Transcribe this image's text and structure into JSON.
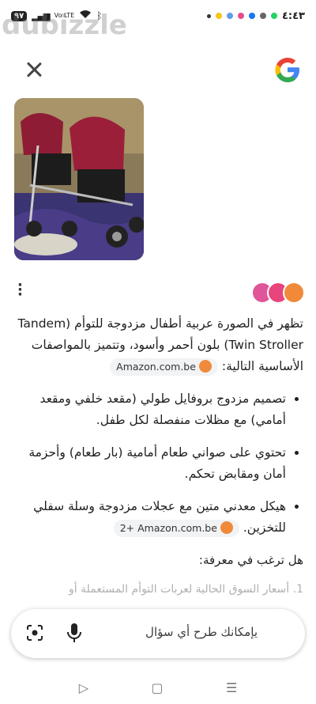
{
  "status_bar": {
    "time": "٤:٤٣",
    "battery": "٩٧",
    "network": "Vo LTE",
    "watermark": "dubizzle"
  },
  "header": {
    "close_label": "close",
    "logo": "G"
  },
  "answer": {
    "intro": "تظهر في الصورة عربية أطفال مزدوجة للتوأم (Tandem Twin Stroller) بلون أحمر وأسود، وتتميز بالمواصفات الأساسية التالية:",
    "intro_source": "Amazon.com.be",
    "bullets": [
      {
        "text": "تصميم مزدوج بروفايل طولي (مقعد خلفي ومقعد أمامي) مع مظلات منفصلة لكل طفل.",
        "source": ""
      },
      {
        "text": "تحتوي على صواني طعام أمامية (بار طعام) وأحزمة أمان ومقابض تحكم.",
        "source": ""
      },
      {
        "text": "هيكل معدني متين مع عجلات مزدوجة وسلة سفلي للتخزين.",
        "source": "2+ Amazon.com.be"
      }
    ],
    "question": "هل ترغب في معرفة:",
    "followup": "1. أسعار السوق الحالية لعربات التوأم المستعملة أو"
  },
  "search": {
    "placeholder": "يإمكانك طرح أي سؤال"
  },
  "colors": {
    "google_blue": "#4285F4",
    "google_red": "#EA4335",
    "google_yellow": "#FBBC05",
    "google_green": "#34A853",
    "source_orange": "#f08a3a"
  }
}
